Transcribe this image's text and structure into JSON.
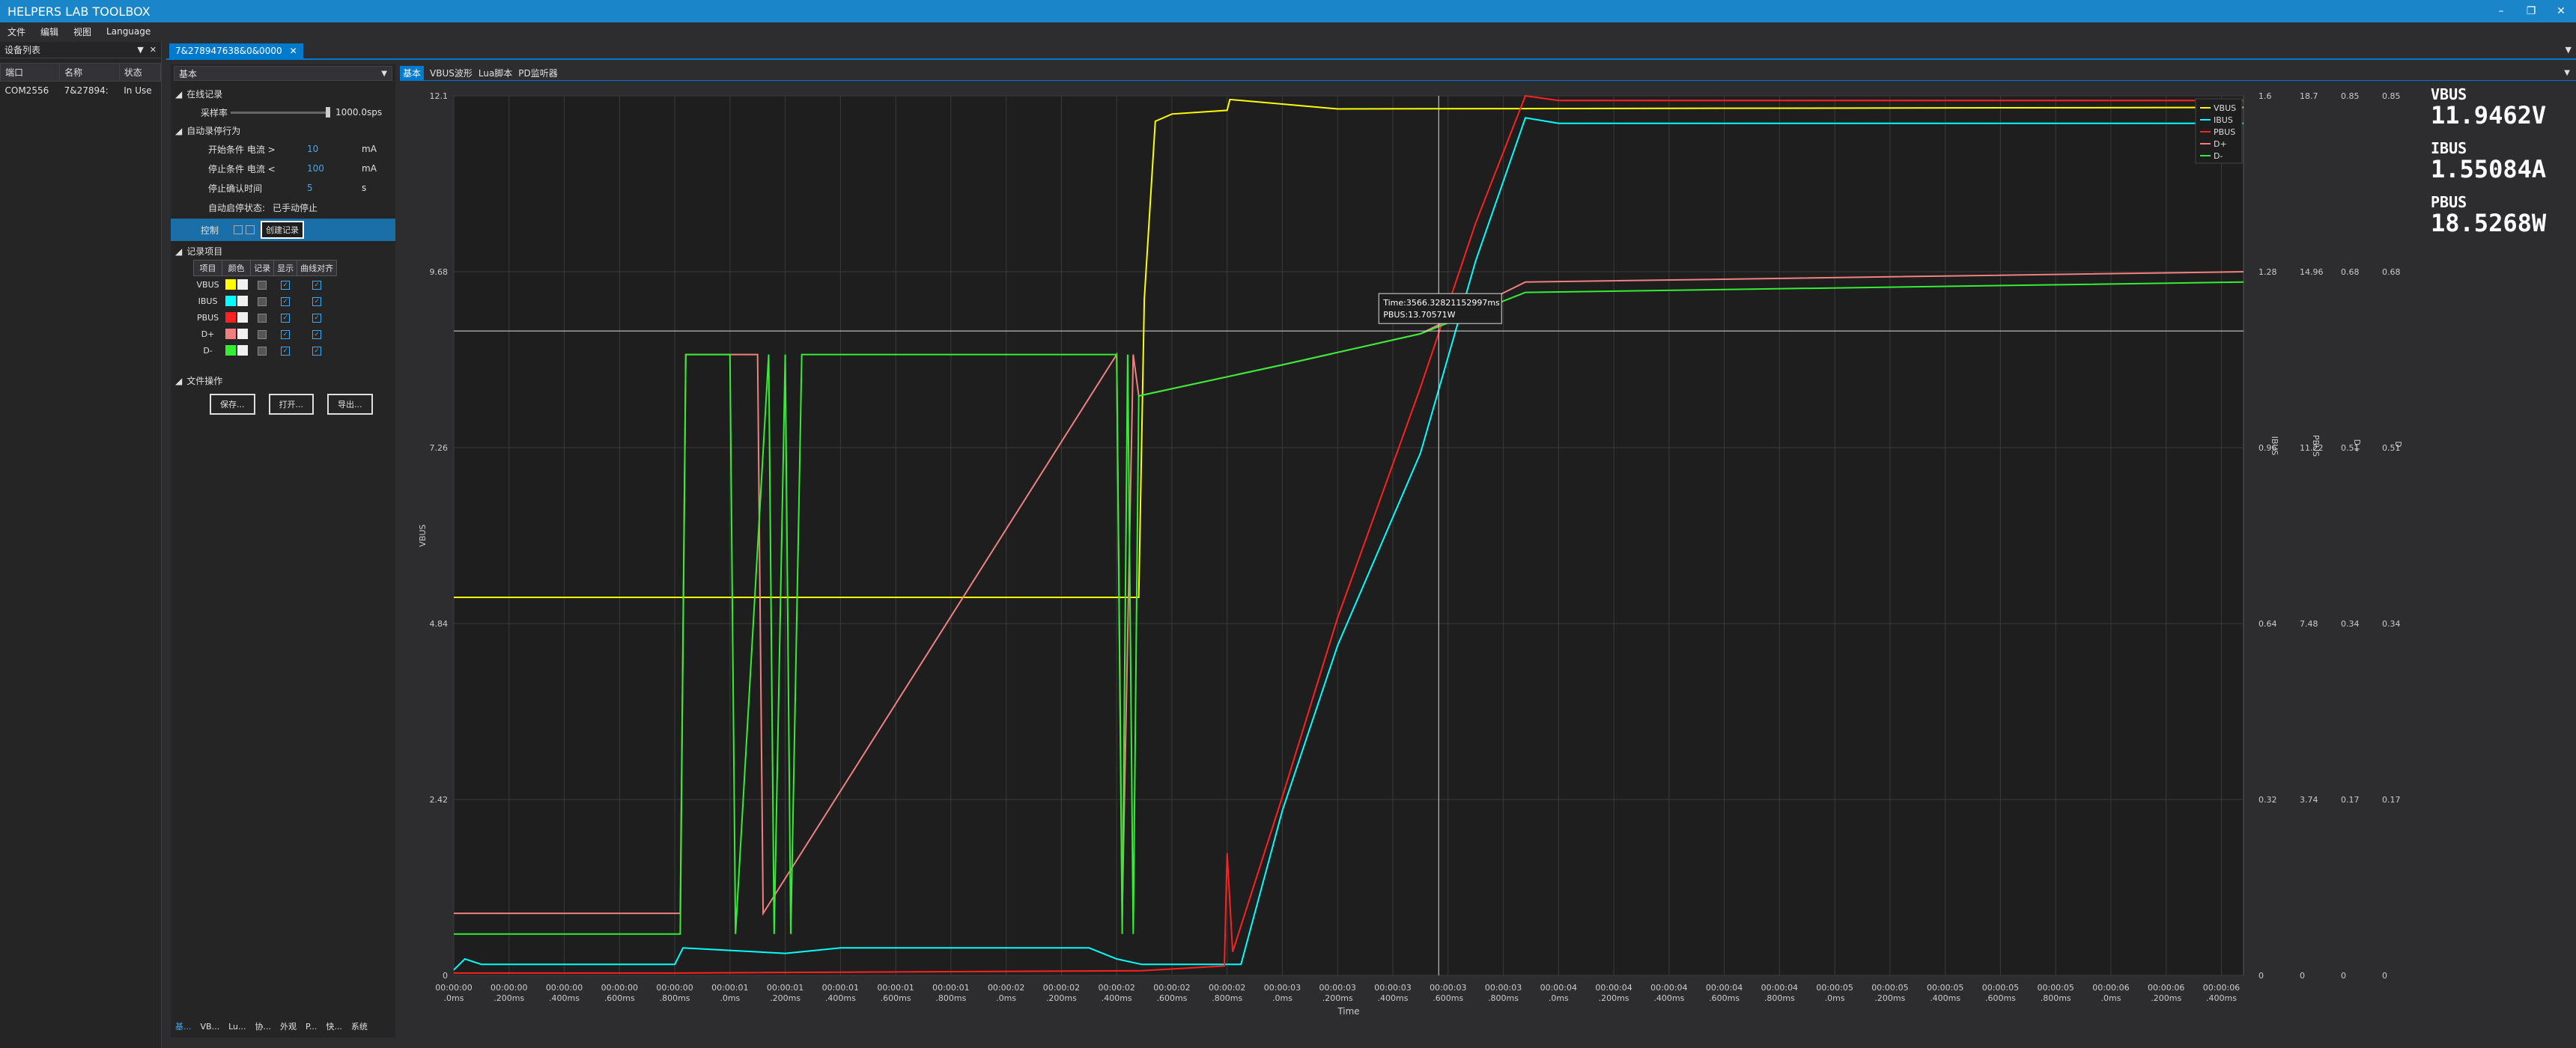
{
  "window": {
    "title": "HELPERS LAB TOOLBOX"
  },
  "menu": [
    "文件",
    "编辑",
    "视图",
    "Language"
  ],
  "device_panel": {
    "title": "设备列表",
    "columns": [
      "端口",
      "名称",
      "状态"
    ],
    "rows": [
      [
        "COM2556",
        "7&27894:",
        "In Use"
      ]
    ]
  },
  "doc_tab": {
    "label": "7&278947638&0&0000"
  },
  "settings": {
    "mode": "基本",
    "online_record": "在线记录",
    "sample_rate_label": "采样率",
    "sample_rate_value": "1000.0sps",
    "auto_record": "自动录停行为",
    "start_cond_label": "开始条件 电流 >",
    "start_cond_value": "10",
    "start_cond_unit": "mA",
    "stop_cond_label": "停止条件 电流 <",
    "stop_cond_value": "100",
    "stop_cond_unit": "mA",
    "stop_confirm_label": "停止确认时间",
    "stop_confirm_value": "5",
    "stop_confirm_unit": "s",
    "auto_status_label": "自动启停状态:",
    "auto_status_value": "已手动停止",
    "control_label": "控制",
    "create_record": "创建记录",
    "record_items": "记录项目",
    "record_columns": [
      "项目",
      "颜色",
      "记录",
      "显示",
      "曲线对齐"
    ],
    "record_rows": [
      {
        "name": "VBUS",
        "color": "#ffff00"
      },
      {
        "name": "IBUS",
        "color": "#00ffff"
      },
      {
        "name": "PBUS",
        "color": "#ff2020"
      },
      {
        "name": "D+",
        "color": "#f08080"
      },
      {
        "name": "D-",
        "color": "#33ee33"
      }
    ],
    "file_ops": "文件操作",
    "file_buttons": [
      "保存...",
      "打开...",
      "导出..."
    ]
  },
  "bottom_tabs": [
    "基...",
    "VB...",
    "Lu...",
    "协...",
    "外观",
    "P...",
    "快...",
    "系统"
  ],
  "chart_tabs": [
    "基本",
    "VBUS波形",
    "Lua脚本",
    "PD监听器"
  ],
  "readouts": [
    {
      "name": "VBUS",
      "value": "11.9462V"
    },
    {
      "name": "IBUS",
      "value": "1.55084A"
    },
    {
      "name": "PBUS",
      "value": "18.5268W"
    }
  ],
  "tooltip": {
    "line1": "Time:3566.32821152997ms",
    "line2": "PBUS:13.70571W"
  },
  "chart_data": {
    "type": "line",
    "xlabel": "Time",
    "x_ticks": [
      [
        "00:00:00",
        ".0ms"
      ],
      [
        "00:00:00",
        ".200ms"
      ],
      [
        "00:00:00",
        ".400ms"
      ],
      [
        "00:00:00",
        ".600ms"
      ],
      [
        "00:00:00",
        ".800ms"
      ],
      [
        "00:00:01",
        ".0ms"
      ],
      [
        "00:00:01",
        ".200ms"
      ],
      [
        "00:00:01",
        ".400ms"
      ],
      [
        "00:00:01",
        ".600ms"
      ],
      [
        "00:00:01",
        ".800ms"
      ],
      [
        "00:00:02",
        ".0ms"
      ],
      [
        "00:00:02",
        ".200ms"
      ],
      [
        "00:00:02",
        ".400ms"
      ],
      [
        "00:00:02",
        ".600ms"
      ],
      [
        "00:00:02",
        ".800ms"
      ],
      [
        "00:00:03",
        ".0ms"
      ],
      [
        "00:00:03",
        ".200ms"
      ],
      [
        "00:00:03",
        ".400ms"
      ],
      [
        "00:00:03",
        ".600ms"
      ],
      [
        "00:00:03",
        ".800ms"
      ],
      [
        "00:00:04",
        ".0ms"
      ],
      [
        "00:00:04",
        ".200ms"
      ],
      [
        "00:00:04",
        ".400ms"
      ],
      [
        "00:00:04",
        ".600ms"
      ],
      [
        "00:00:04",
        ".800ms"
      ],
      [
        "00:00:05",
        ".0ms"
      ],
      [
        "00:00:05",
        ".200ms"
      ],
      [
        "00:00:05",
        ".400ms"
      ],
      [
        "00:00:05",
        ".600ms"
      ],
      [
        "00:00:05",
        ".800ms"
      ],
      [
        "00:00:06",
        ".0ms"
      ],
      [
        "00:00:06",
        ".200ms"
      ],
      [
        "00:00:06",
        ".400ms"
      ]
    ],
    "x_range_ms": [
      0,
      6480
    ],
    "left_axis": {
      "label": "VBUS",
      "ticks": [
        "12.1",
        "9.68",
        "7.26",
        "4.84",
        "2.42",
        "0"
      ]
    },
    "right_axes": [
      {
        "label": "IBUS",
        "ticks": [
          "1.6",
          "1.28",
          "0.96",
          "0.64",
          "0.32",
          "0"
        ]
      },
      {
        "label": "PBUS",
        "ticks": [
          "18.7",
          "14.96",
          "11.22",
          "7.48",
          "3.74",
          "0"
        ]
      },
      {
        "label": "D+",
        "ticks": [
          "0.85",
          "0.68",
          "0.51",
          "0.34",
          "0.17",
          "0"
        ]
      },
      {
        "label": "D-",
        "ticks": [
          "0.85",
          "0.68",
          "0.51",
          "0.34",
          "0.17",
          "0"
        ]
      }
    ],
    "legend": [
      "VBUS",
      "IBUS",
      "PBUS",
      "D+",
      "D-"
    ],
    "legend_position": "top-right",
    "grid": true,
    "crosshair": {
      "x_ms": 3566,
      "pbus_w": 13.7
    },
    "series": [
      {
        "name": "VBUS",
        "color": "#ffff00",
        "x": [
          0,
          2480,
          2500,
          2540,
          2600,
          2800,
          2810,
          3200,
          6480
        ],
        "y": [
          5.2,
          5.2,
          9.3,
          11.75,
          11.85,
          11.9,
          12.05,
          11.92,
          11.94
        ]
      },
      {
        "name": "IBUS",
        "color": "#00ffff",
        "x": [
          0,
          40,
          100,
          800,
          830,
          1200,
          1400,
          1600,
          2300,
          2400,
          2490,
          2850,
          3000,
          3200,
          3500,
          3700,
          3880,
          4000,
          6480
        ],
        "y": [
          0.01,
          0.03,
          0.02,
          0.02,
          0.05,
          0.04,
          0.05,
          0.05,
          0.05,
          0.03,
          0.02,
          0.02,
          0.3,
          0.6,
          0.95,
          1.3,
          1.56,
          1.55,
          1.55
        ]
      },
      {
        "name": "PBUS",
        "color": "#ff2020",
        "x": [
          0,
          800,
          2490,
          2790,
          2800,
          2820,
          3000,
          3200,
          3500,
          3700,
          3880,
          4000,
          6480
        ],
        "y": [
          0.05,
          0.05,
          0.1,
          0.2,
          2.6,
          0.5,
          3.8,
          7.6,
          12.5,
          16.0,
          18.7,
          18.6,
          18.6
        ]
      },
      {
        "name": "D+",
        "color": "#f08080",
        "x": [
          0,
          820,
          840,
          1100,
          1120,
          2400,
          2420,
          2460,
          2480,
          3000,
          3500,
          3880,
          6480
        ],
        "y": [
          0.06,
          0.06,
          0.6,
          0.6,
          0.06,
          0.6,
          0.06,
          0.6,
          0.56,
          0.59,
          0.62,
          0.67,
          0.68
        ]
      },
      {
        "name": "D-",
        "color": "#33ee33",
        "x": [
          0,
          820,
          840,
          1000,
          1020,
          1140,
          1160,
          1200,
          1220,
          1260,
          1280,
          2400,
          2420,
          2440,
          2460,
          2480,
          3000,
          3500,
          3880,
          6480
        ],
        "y": [
          0.04,
          0.04,
          0.6,
          0.6,
          0.04,
          0.6,
          0.04,
          0.6,
          0.04,
          0.6,
          0.6,
          0.6,
          0.04,
          0.6,
          0.04,
          0.56,
          0.59,
          0.62,
          0.66,
          0.67
        ]
      }
    ]
  }
}
